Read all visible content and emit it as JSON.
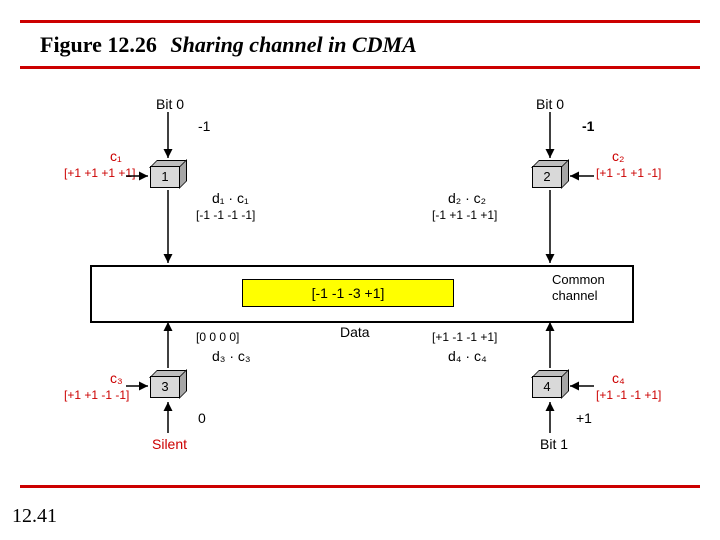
{
  "figure": {
    "number": "Figure 12.26",
    "caption": "Sharing channel in CDMA"
  },
  "page": "12.41",
  "top": {
    "left": {
      "bitlabel": "Bit 0",
      "bitval": "-1"
    },
    "right": {
      "bitlabel": "Bit 0",
      "bitval": "-1"
    }
  },
  "bottom": {
    "left": {
      "bitlabel": "Silent",
      "bitval": "0"
    },
    "right": {
      "bitlabel": "Bit 1",
      "bitval": "+1"
    }
  },
  "codes": {
    "c1": {
      "name": "c₁",
      "vec": "[+1 +1  +1 +1]"
    },
    "c2": {
      "name": "c₂",
      "vec": "[+1 -1  +1 -1]"
    },
    "c3": {
      "name": "c₃",
      "vec": "[+1 +1  -1 -1]"
    },
    "c4": {
      "name": "c₄",
      "vec": "[+1 -1  -1 +1]"
    }
  },
  "mult": {
    "m1": {
      "num": "1",
      "expr": "d₁ · c₁",
      "vec": "[-1 -1  -1 -1]"
    },
    "m2": {
      "num": "2",
      "expr": "d₂ · c₂",
      "vec": "[-1 +1  -1 +1]"
    },
    "m3": {
      "num": "3",
      "expr": "d₃ · c₃",
      "vec": "[0  0  0  0]"
    },
    "m4": {
      "num": "4",
      "expr": "d₄ · c₄",
      "vec": "[+1 -1  -1 +1]"
    }
  },
  "channel": {
    "sum": "[-1  -1  -3  +1]",
    "label_data": "Data",
    "label_common": "Common\nchannel"
  }
}
